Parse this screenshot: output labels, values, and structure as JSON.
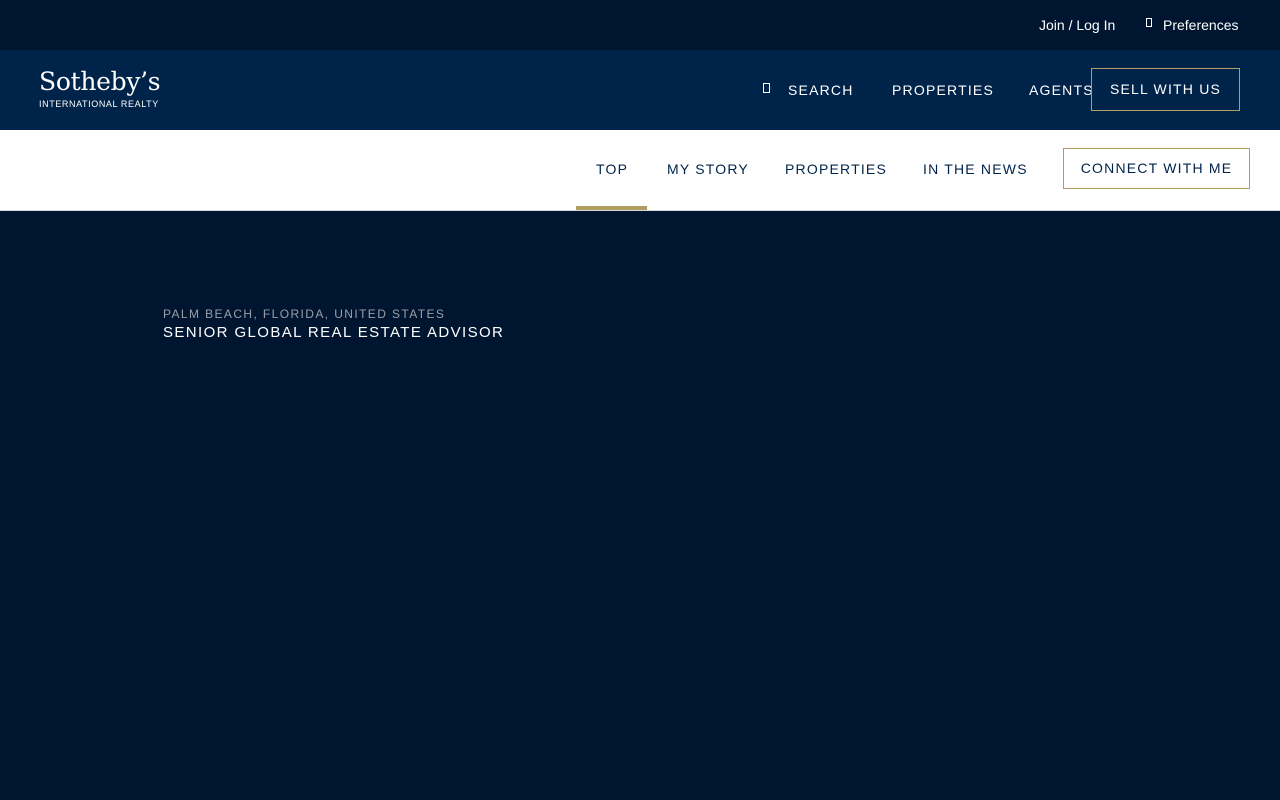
{
  "utility": {
    "login": "Join / Log In",
    "preferences": "Preferences"
  },
  "header": {
    "logo_word": "Sotheby’s",
    "logo_sub": "INTERNATIONAL REALTY",
    "nav": {
      "search": "SEARCH",
      "properties": "PROPERTIES",
      "agents": "AGENTS"
    },
    "sell_button": "SELL WITH US"
  },
  "subnav": {
    "items": [
      "TOP",
      "MY STORY",
      "PROPERTIES",
      "IN THE NEWS"
    ],
    "active": "TOP",
    "connect_button": "CONNECT WITH ME"
  },
  "hero": {
    "location": "PALM BEACH, FLORIDA, UNITED STATES",
    "title": "SENIOR GLOBAL REAL ESTATE ADVISOR"
  },
  "colors": {
    "navy_dark": "#001530",
    "navy": "#002349",
    "gold": "#b19c62",
    "white": "#ffffff"
  },
  "icons": {
    "search": "search-icon",
    "preferences": "preferences-icon"
  }
}
